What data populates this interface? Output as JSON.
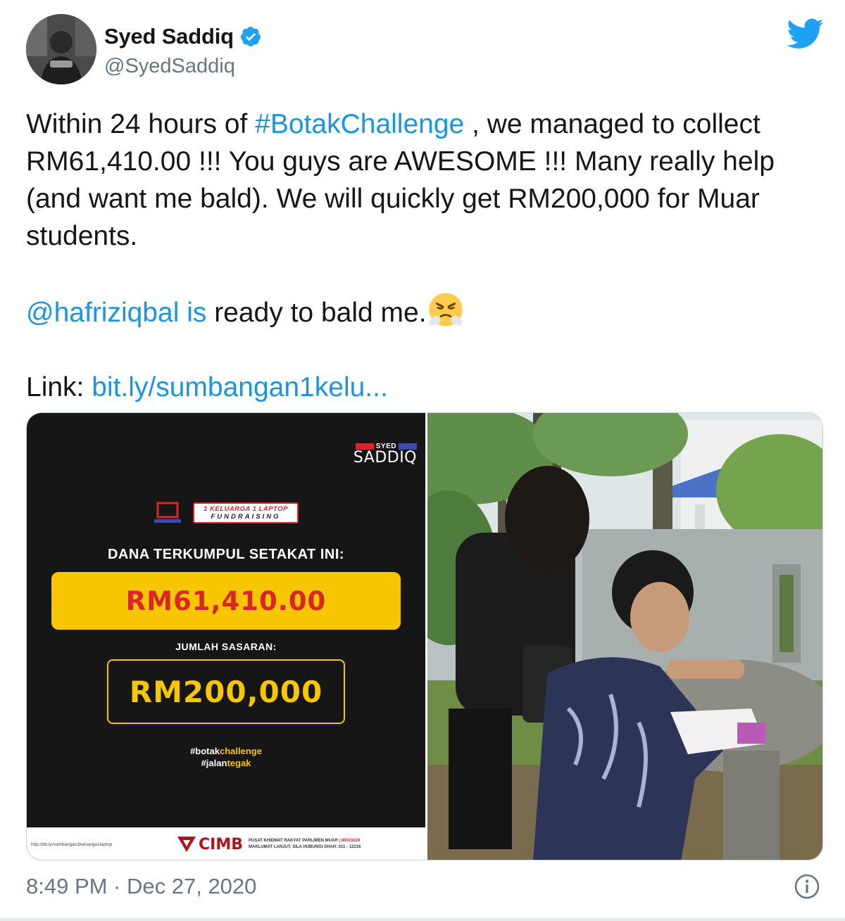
{
  "author": {
    "display_name": "Syed Saddiq",
    "handle": "@SyedSaddiq",
    "verified": true,
    "avatar_icon": "profile-photo"
  },
  "tweet": {
    "line1_pre": "Within 24 hours of ",
    "line1_hashtag": "#BotakChallenge",
    "line1_post": " , we managed to collect",
    "line2": "RM61,410.00 !!! You guys are AWESOME !!! Many really help",
    "line3": "(and want me bald). We will quickly get RM200,000 for Muar",
    "line4": "students.",
    "mention": "@hafriziqbal is",
    "mention_post": " ready to bald me.",
    "emoji": "face-with-steam-from-nose",
    "link_label": "Link: ",
    "link_text": "bit.ly/sumbangan1kelu..."
  },
  "poster": {
    "brand_small": "SYED",
    "brand_name": "SADDIQ",
    "campaign_line1": "1 KELUARGA 1 LAPTOP",
    "campaign_line2": "FUNDRAISING",
    "collected_label": "DANA TERKUMPUL SETAKAT INI:",
    "collected_value": "RM61,410.00",
    "target_label": "JUMLAH SASARAN:",
    "target_value": "RM200,000",
    "hashtag1_a": "#botak",
    "hashtag1_b": "challenge",
    "hashtag2_a": "#jalan",
    "hashtag2_b": "tegak",
    "footer_url": "http://bit.ly/sumbangan1keluarga1laptop",
    "bank": "CIMB",
    "footer_info1": "PUSAT KHIDMAT RAKYAT PARLIMEN MUAR",
    "footer_info1_acct": "| 80023220",
    "footer_info2": "MAKLUMAT LANJUT, SILA HUBUNGI SHAH: 011 - 12216"
  },
  "meta": {
    "timestamp": "8:49 PM · Dec 27, 2020"
  },
  "colors": {
    "link": "#1b95e0",
    "poster_bg": "#161616",
    "poster_yellow": "#f7c600",
    "poster_red": "#d9262b",
    "muted": "#657786"
  }
}
